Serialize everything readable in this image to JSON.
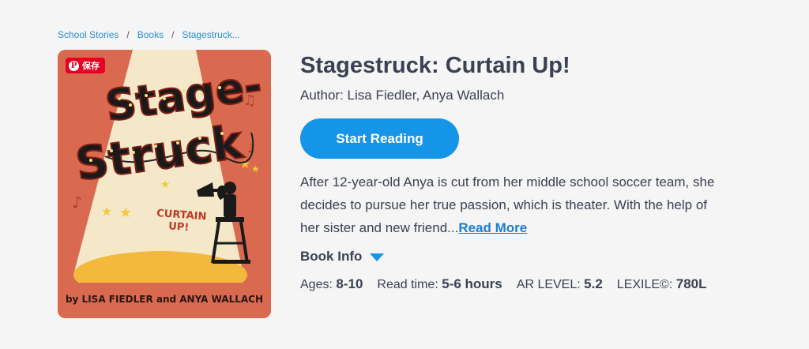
{
  "breadcrumb": {
    "items": [
      "School Stories",
      "Books",
      "Stagestruck..."
    ],
    "separator": "/"
  },
  "cover": {
    "pin_label": "保存",
    "pin_logo": "P",
    "art_title_line1": "Stage-",
    "art_title_line2": "Struck",
    "art_subtitle_line1": "CURTAIN",
    "art_subtitle_line2": "UP!",
    "art_authors": "by LISA FIEDLER and ANYA WALLACH"
  },
  "book": {
    "title": "Stagestruck: Curtain Up!",
    "author": "Author: Lisa Fiedler, Anya Wallach",
    "start_label": "Start Reading",
    "description": "After 12-year-old Anya is cut from her middle school soccer team, she decides to pursue her true passion, which is theater. With the help of her sister and new friend...",
    "read_more": "Read More",
    "book_info_label": "Book Info"
  },
  "meta": {
    "ages_label": "Ages:",
    "ages_value": "8-10",
    "read_time_label": "Read time:",
    "read_time_value": "5-6 hours",
    "ar_label": "AR LEVEL:",
    "ar_value": "5.2",
    "lexile_label": "LEXILE©:",
    "lexile_value": "780L"
  },
  "colors": {
    "accent": "#1495e8",
    "link": "#1a7ed0",
    "cover_bg": "#d96a4f",
    "pin_red": "#e60023"
  }
}
